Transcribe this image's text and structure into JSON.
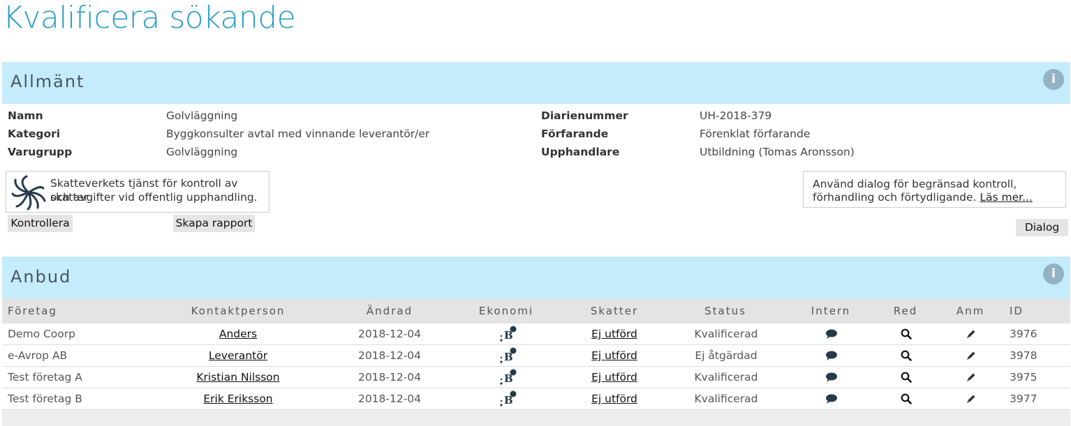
{
  "page": {
    "title": "Kvalificera sökande"
  },
  "allmant": {
    "title": "Allmänt",
    "left_fields": [
      {
        "label": "Namn",
        "value": "Golvläggning"
      },
      {
        "label": "Kategori",
        "value": "Byggkonsulter avtal med vinnande leverantör/er"
      },
      {
        "label": "Varugrupp",
        "value": "Golvläggning"
      }
    ],
    "right_fields": [
      {
        "label": "Diarienummer",
        "value": "UH-2018-379"
      },
      {
        "label": "Förfarande",
        "value": "Förenklat förfarande"
      },
      {
        "label": "Upphandlare",
        "value": "Utbildning (Tomas Aronsson)"
      }
    ],
    "skatteverket_text_1": "Skatteverkets tjänst för kontroll av skatter",
    "skatteverket_text_2": "och avgifter vid offentlig upphandling.",
    "kontrollera_label": "Kontrollera",
    "skapa_rapport_label": "Skapa rapport",
    "dialog_text_1": "Använd dialog för begränsad kontroll,",
    "dialog_text_2": "förhandling och förtydligande.",
    "las_mer_label": "Läs mer...",
    "dialog_label": "Dialog"
  },
  "anbud": {
    "title": "Anbud",
    "columns": [
      "Företag",
      "Kontaktperson",
      "Ändrad",
      "Ekonomi",
      "Skatter",
      "Status",
      "Intern",
      "Red",
      "Anm",
      "ID"
    ],
    "rows": [
      {
        "foretag": "Demo Coorp",
        "kontaktperson": "Anders",
        "andrad": "2018-12-04",
        "skatter": "Ej utförd",
        "status": "Kvalificerad",
        "id": "3976"
      },
      {
        "foretag": "e-Avrop AB",
        "kontaktperson": "Leverantör",
        "andrad": "2018-12-04",
        "skatter": "Ej utförd",
        "status": "Ej åtgärdad",
        "id": "3978"
      },
      {
        "foretag": "Test företag A",
        "kontaktperson": "Kristian Nilsson",
        "andrad": "2018-12-04",
        "skatter": "Ej utförd",
        "status": "Kvalificerad",
        "id": "3975"
      },
      {
        "foretag": "Test företag B",
        "kontaktperson": "Erik Eriksson",
        "andrad": "2018-12-04",
        "skatter": "Ej utförd",
        "status": "Kvalificerad",
        "id": "3977"
      }
    ]
  },
  "colors": {
    "title": "#2a9cc8",
    "section_header": "#c4ecfc",
    "info_icon": "#93b3c5",
    "icon": "#243a4a"
  },
  "icons": {
    "info": "info-icon",
    "ekonomi": "bisnode-logo-icon",
    "intern": "comment-icon",
    "red": "search-icon",
    "anm": "pencil-icon",
    "skatteverket": "skatteverket-logo"
  }
}
